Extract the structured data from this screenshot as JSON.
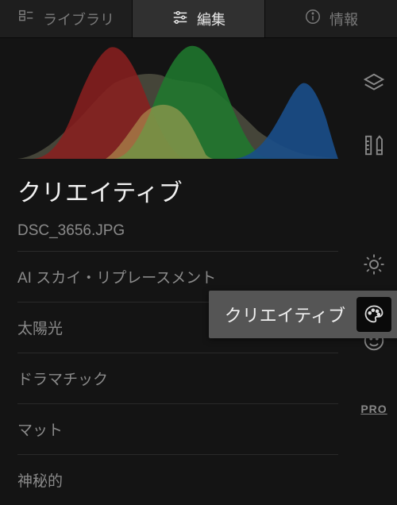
{
  "tabs": {
    "library": "ライブラリ",
    "edit": "編集",
    "info": "情報"
  },
  "section": {
    "title": "クリエイティブ",
    "filename": "DSC_3656.JPG"
  },
  "presets": [
    "AI スカイ・リプレースメント",
    "太陽光",
    "ドラマチック",
    "マット",
    "神秘的"
  ],
  "tooltip": {
    "label": "クリエイティブ"
  },
  "rail": {
    "pro": "PRO"
  }
}
